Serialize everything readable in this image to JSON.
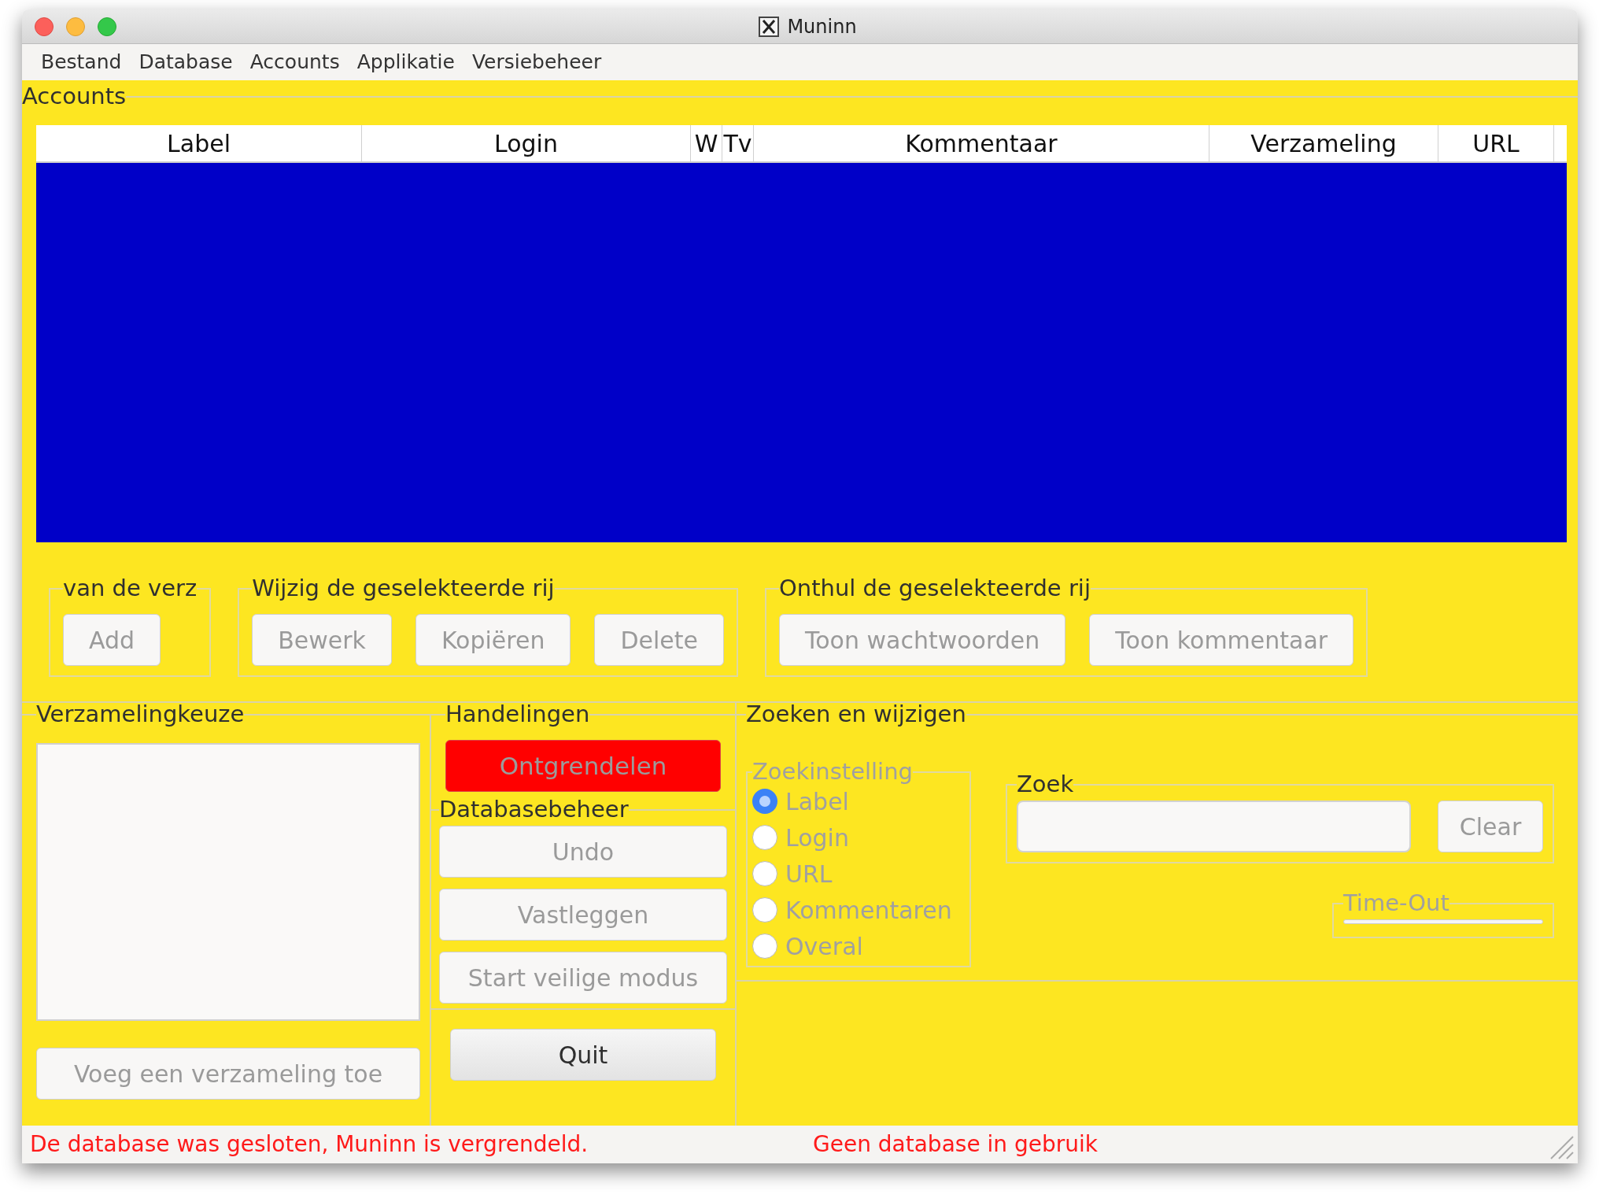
{
  "window": {
    "title": "Muninn"
  },
  "menu": [
    "Bestand",
    "Database",
    "Accounts",
    "Applikatie",
    "Versiebeheer"
  ],
  "accounts": {
    "title": "Accounts",
    "columns": [
      "Label",
      "Login",
      "W",
      "Tv",
      "Kommentaar",
      "Verzameling",
      "URL"
    ]
  },
  "groups": [
    {
      "title": "van de verz",
      "buttons": [
        {
          "label": "Add",
          "disabled": true
        }
      ]
    },
    {
      "title": "Wijzig de geselekteerde rij",
      "buttons": [
        {
          "label": "Bewerk",
          "disabled": true
        },
        {
          "label": "Kopiëren",
          "disabled": true
        },
        {
          "label": "Delete",
          "disabled": true
        }
      ]
    },
    {
      "title": "Onthul de geselekteerde rij",
      "buttons": [
        {
          "label": "Toon wachtwoorden",
          "disabled": true
        },
        {
          "label": "Toon kommentaar",
          "disabled": true
        }
      ]
    }
  ],
  "collection": {
    "title": "Verzamelingkeuze",
    "add_button": {
      "label": "Voeg een verzameling toe",
      "disabled": true
    }
  },
  "actions": {
    "title": "Handelingen",
    "unlock_button": {
      "label": "Ontgrendelen",
      "disabled": true
    },
    "database": {
      "title": "Databasebeheer",
      "buttons": [
        {
          "label": "Undo",
          "disabled": true
        },
        {
          "label": "Vastleggen",
          "disabled": true
        },
        {
          "label": "Start veilige modus",
          "disabled": true
        }
      ]
    },
    "quit_button": {
      "label": "Quit",
      "disabled": false
    }
  },
  "search": {
    "title": "Zoeken en wijzigen",
    "settings": {
      "title": "Zoekinstelling",
      "disabled": true,
      "options": [
        {
          "label": "Label",
          "selected": true
        },
        {
          "label": "Login",
          "selected": false
        },
        {
          "label": "URL",
          "selected": false
        },
        {
          "label": "Kommentaren",
          "selected": false
        },
        {
          "label": "Overal",
          "selected": false
        }
      ]
    },
    "query": {
      "title": "Zoek",
      "clear_button": {
        "label": "Clear",
        "disabled": true
      }
    },
    "timeout": {
      "title": "Time-Out",
      "disabled": true
    }
  },
  "status_bar": {
    "message": "De database was gesloten, Muninn is vergrendeld.",
    "database": "Geen database in gebruik"
  }
}
